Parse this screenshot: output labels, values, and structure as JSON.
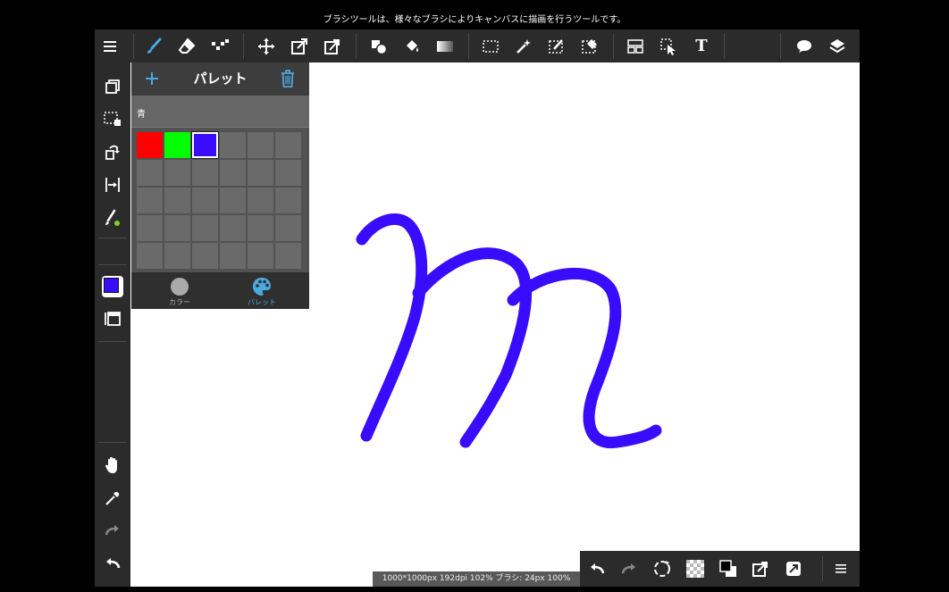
{
  "hint_text": "ブラシツールは、様々なブラシによりキャンバスに描画を行うツールです。",
  "icons": {
    "menu": "hamburger-menu-icon",
    "brush": "brush-icon",
    "eraser": "eraser-icon",
    "dot": "dot-tool-icon",
    "move": "move-icon",
    "transform": "transform-icon",
    "warp": "warp-icon",
    "shape": "shape-icon",
    "fill": "bucket-fill-icon",
    "gradient": "gradient-icon",
    "select": "select-icon",
    "magic_wand": "magic-wand-icon",
    "select_pen": "select-pen-icon",
    "select_eraser": "select-eraser-icon",
    "frame": "frame-divider-icon",
    "operation": "operation-icon",
    "text_tool": "text-tool-icon",
    "balloon": "balloon-icon",
    "layers": "layers-icon"
  },
  "text_tool_label": "T",
  "palette": {
    "title": "パレット",
    "name": "青",
    "colors": [
      "#ff0000",
      "#00ff00",
      "#3a0cff"
    ],
    "selected_index": 2,
    "tabs": [
      {
        "label": "カラー",
        "active": false
      },
      {
        "label": "パレット",
        "active": true
      }
    ]
  },
  "status_text": "1000*1000px 192dpi 102% ブラシ: 24px 100%",
  "colors": {
    "accent": "#4aa8e0",
    "stroke": "#3a0cff",
    "primary_color": "#3a0cff",
    "toolbar_bg": "#2b2b2b"
  }
}
